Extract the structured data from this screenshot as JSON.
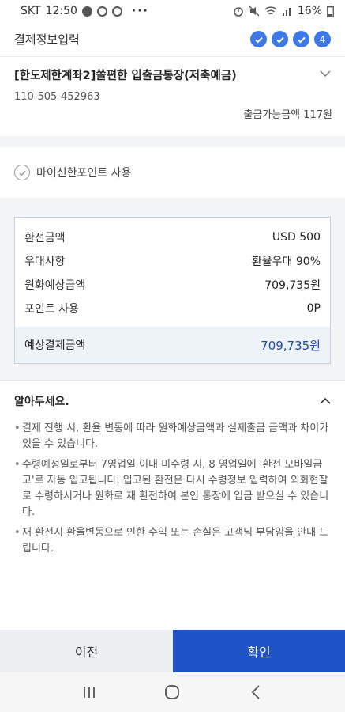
{
  "status_bar": {
    "carrier": "SKT",
    "time": "12:50",
    "dots": "···",
    "battery": "16%"
  },
  "header": {
    "title": "결제정보입력",
    "steps": [
      "✓",
      "✓",
      "✓",
      "4"
    ]
  },
  "account": {
    "name": "[한도제한계좌2]쏠편한 입출금통장(저축예금)",
    "number": "110-505-452963",
    "balance": "출금가능금액 117원"
  },
  "point": {
    "label": "마이신한포인트 사용"
  },
  "summary": {
    "rows": [
      {
        "label": "환전금액",
        "value": "USD 500"
      },
      {
        "label": "우대사항",
        "value": "환율우대 90%"
      },
      {
        "label": "원화예상금액",
        "value": "709,735원"
      },
      {
        "label": "포인트 사용",
        "value": "0P"
      }
    ],
    "total_label": "예상결제금액",
    "total_value": "709,735원"
  },
  "notice": {
    "title": "알아두세요.",
    "items": [
      "결제 진행 시, 환율 변동에 따라 원화예상금액과 실제출금 금액과 차이가 있을 수 있습니다.",
      "수령예정일로부터 7영업일 이내 미수령 시, 8 영업일에 '환전 모바일금고'로 자동 입고됩니다. 입고된 환전은 다시 수령정보 입력하여 외화현찰로 수령하시거나 원화로 재 환전하여 본인 통장에 입금 받으실 수 있습니다.",
      "재 환전시 환율변동으로 인한 수익 또는 손실은 고객님 부담임을 안내 드립니다."
    ]
  },
  "buttons": {
    "prev": "이전",
    "confirm": "확인"
  },
  "colors": {
    "accent": "#1e52c5",
    "step": "#3c78e6",
    "total_value": "#1f4aa8"
  }
}
